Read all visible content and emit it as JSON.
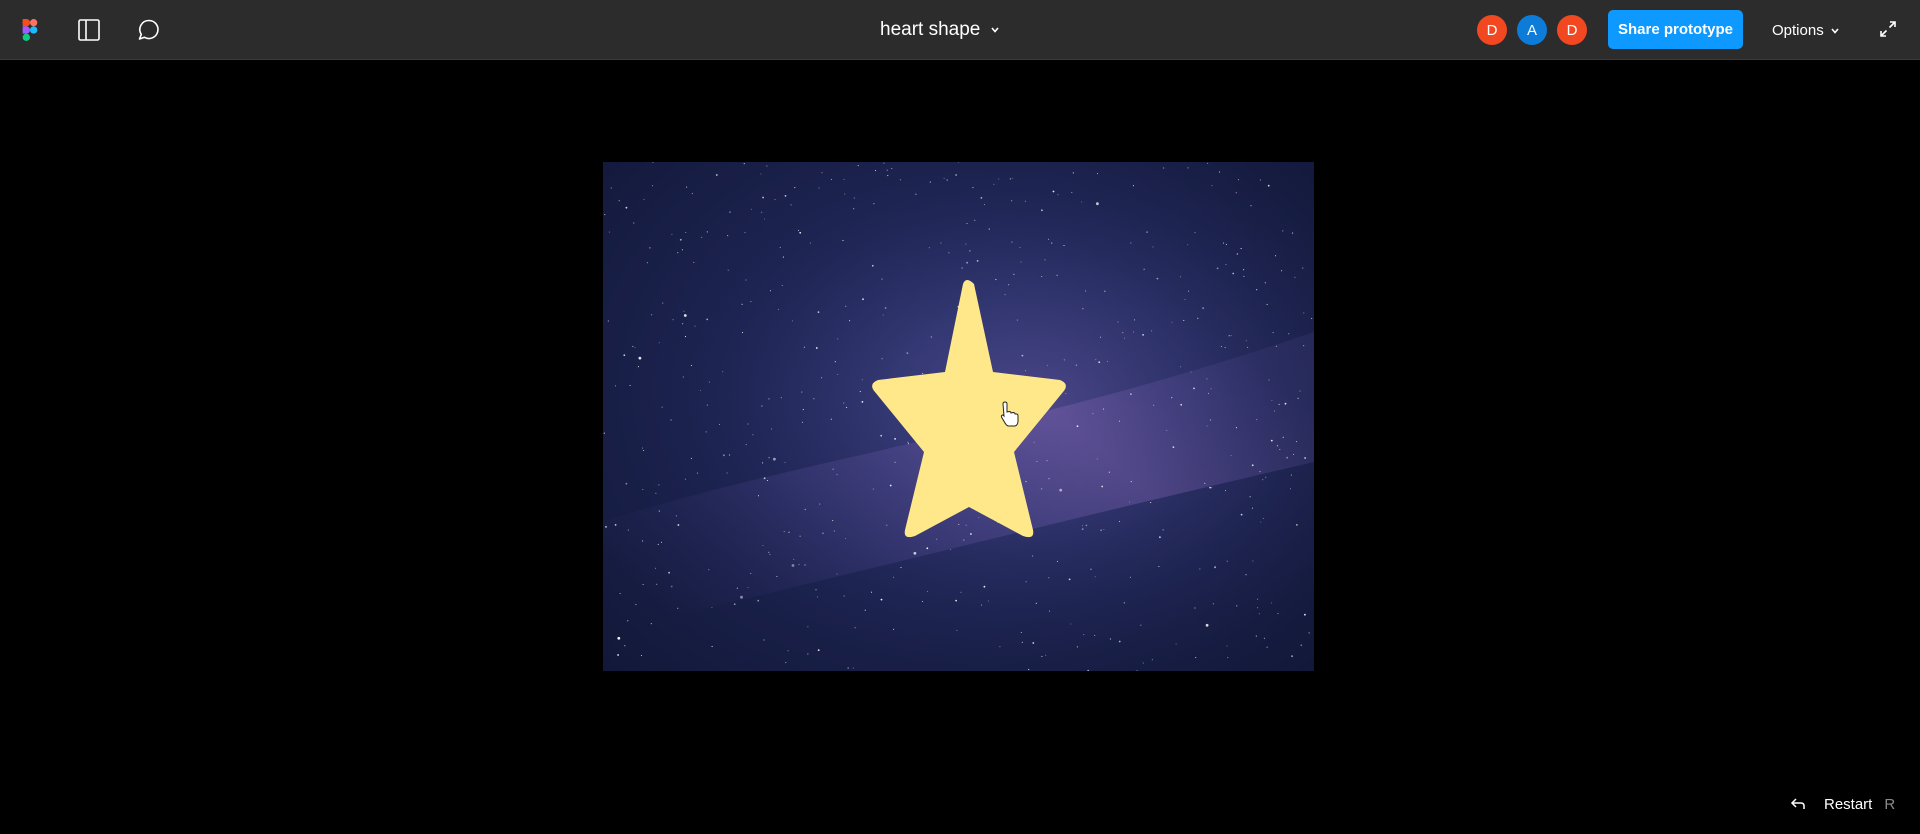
{
  "toolbar": {
    "title": "heart shape",
    "share_label": "Share prototype",
    "options_label": "Options",
    "avatars": [
      {
        "initial": "D",
        "color": "#f24822"
      },
      {
        "initial": "A",
        "color": "#0d7bd8"
      },
      {
        "initial": "D",
        "color": "#f24822"
      }
    ],
    "icons": {
      "logo": "figma-logo-icon",
      "sidebar": "sidebar-toggle-icon",
      "comment": "comment-icon",
      "title_menu": "chevron-down-icon",
      "options_menu": "chevron-down-icon",
      "fullscreen": "expand-icon"
    }
  },
  "canvas": {
    "frame_image": "starry-night-sky",
    "shape": "star",
    "star_color": "#ffe88a"
  },
  "footer": {
    "restart_label": "Restart",
    "restart_shortcut": "R",
    "restart_icon": "undo-arrow-icon"
  },
  "colors": {
    "toolbar_bg": "#2c2c2c",
    "background": "#000000",
    "accent": "#0d99ff"
  }
}
